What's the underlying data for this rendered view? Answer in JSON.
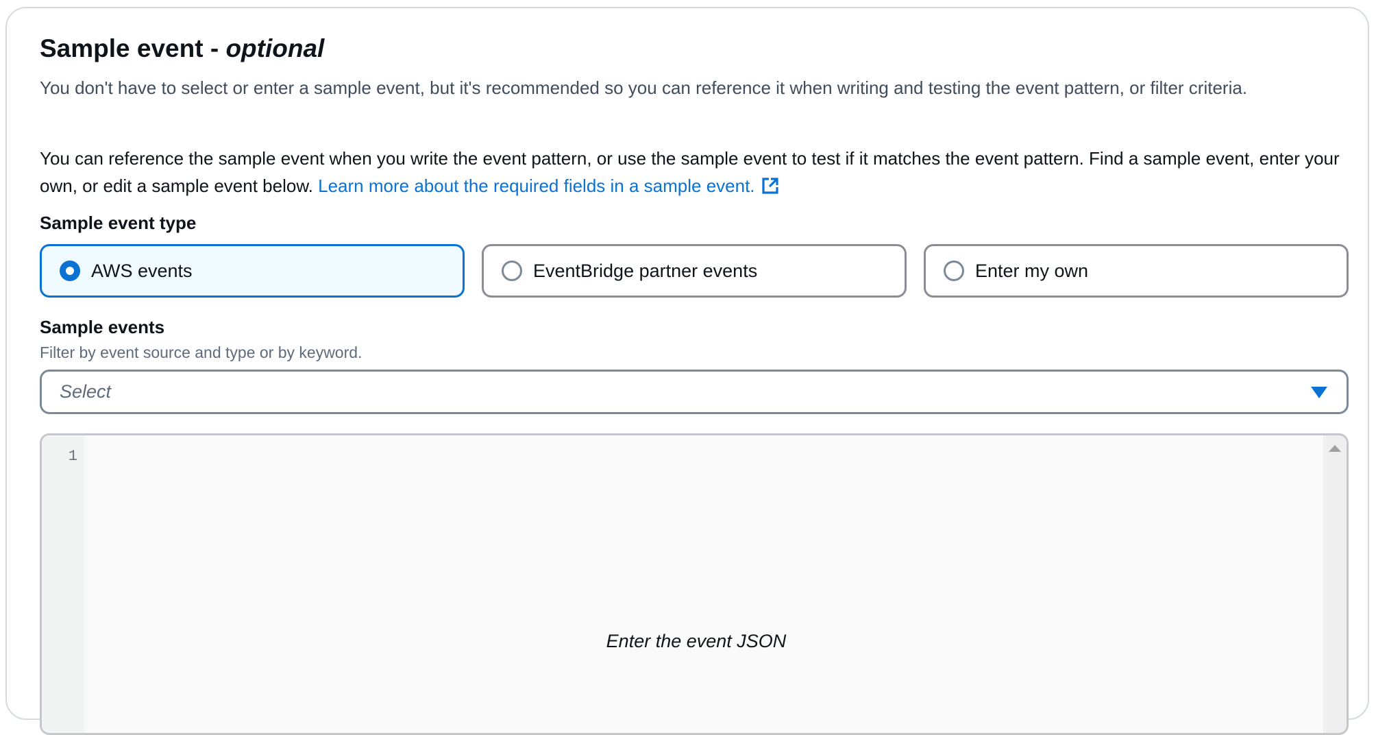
{
  "section": {
    "title_main": "Sample event - ",
    "title_optional": "optional",
    "description": "You don't have to select or enter a sample event, but it's recommended so you can reference it when writing and testing the event pattern, or filter criteria.",
    "paragraph": "You can reference the sample event when you write the event pattern, or use the sample event to test if it matches the event pattern. Find a sample event, enter your own, or edit a sample event below.",
    "learn_more_link": "Learn more about the required fields in a sample event.",
    "link_icon": "external-link-icon",
    "accent_color": "#0972d3"
  },
  "event_type": {
    "label": "Sample event type",
    "selected": "AWS events",
    "options": [
      {
        "label": "AWS events",
        "selected": true
      },
      {
        "label": "EventBridge partner events",
        "selected": false
      },
      {
        "label": "Enter my own",
        "selected": false
      }
    ]
  },
  "sample_events": {
    "label": "Sample events",
    "hint": "Filter by event source and type or by keyword.",
    "placeholder": "Select",
    "dropdown_icon": "caret-down-icon"
  },
  "editor": {
    "line_number": "1",
    "placeholder": "Enter the event JSON"
  }
}
